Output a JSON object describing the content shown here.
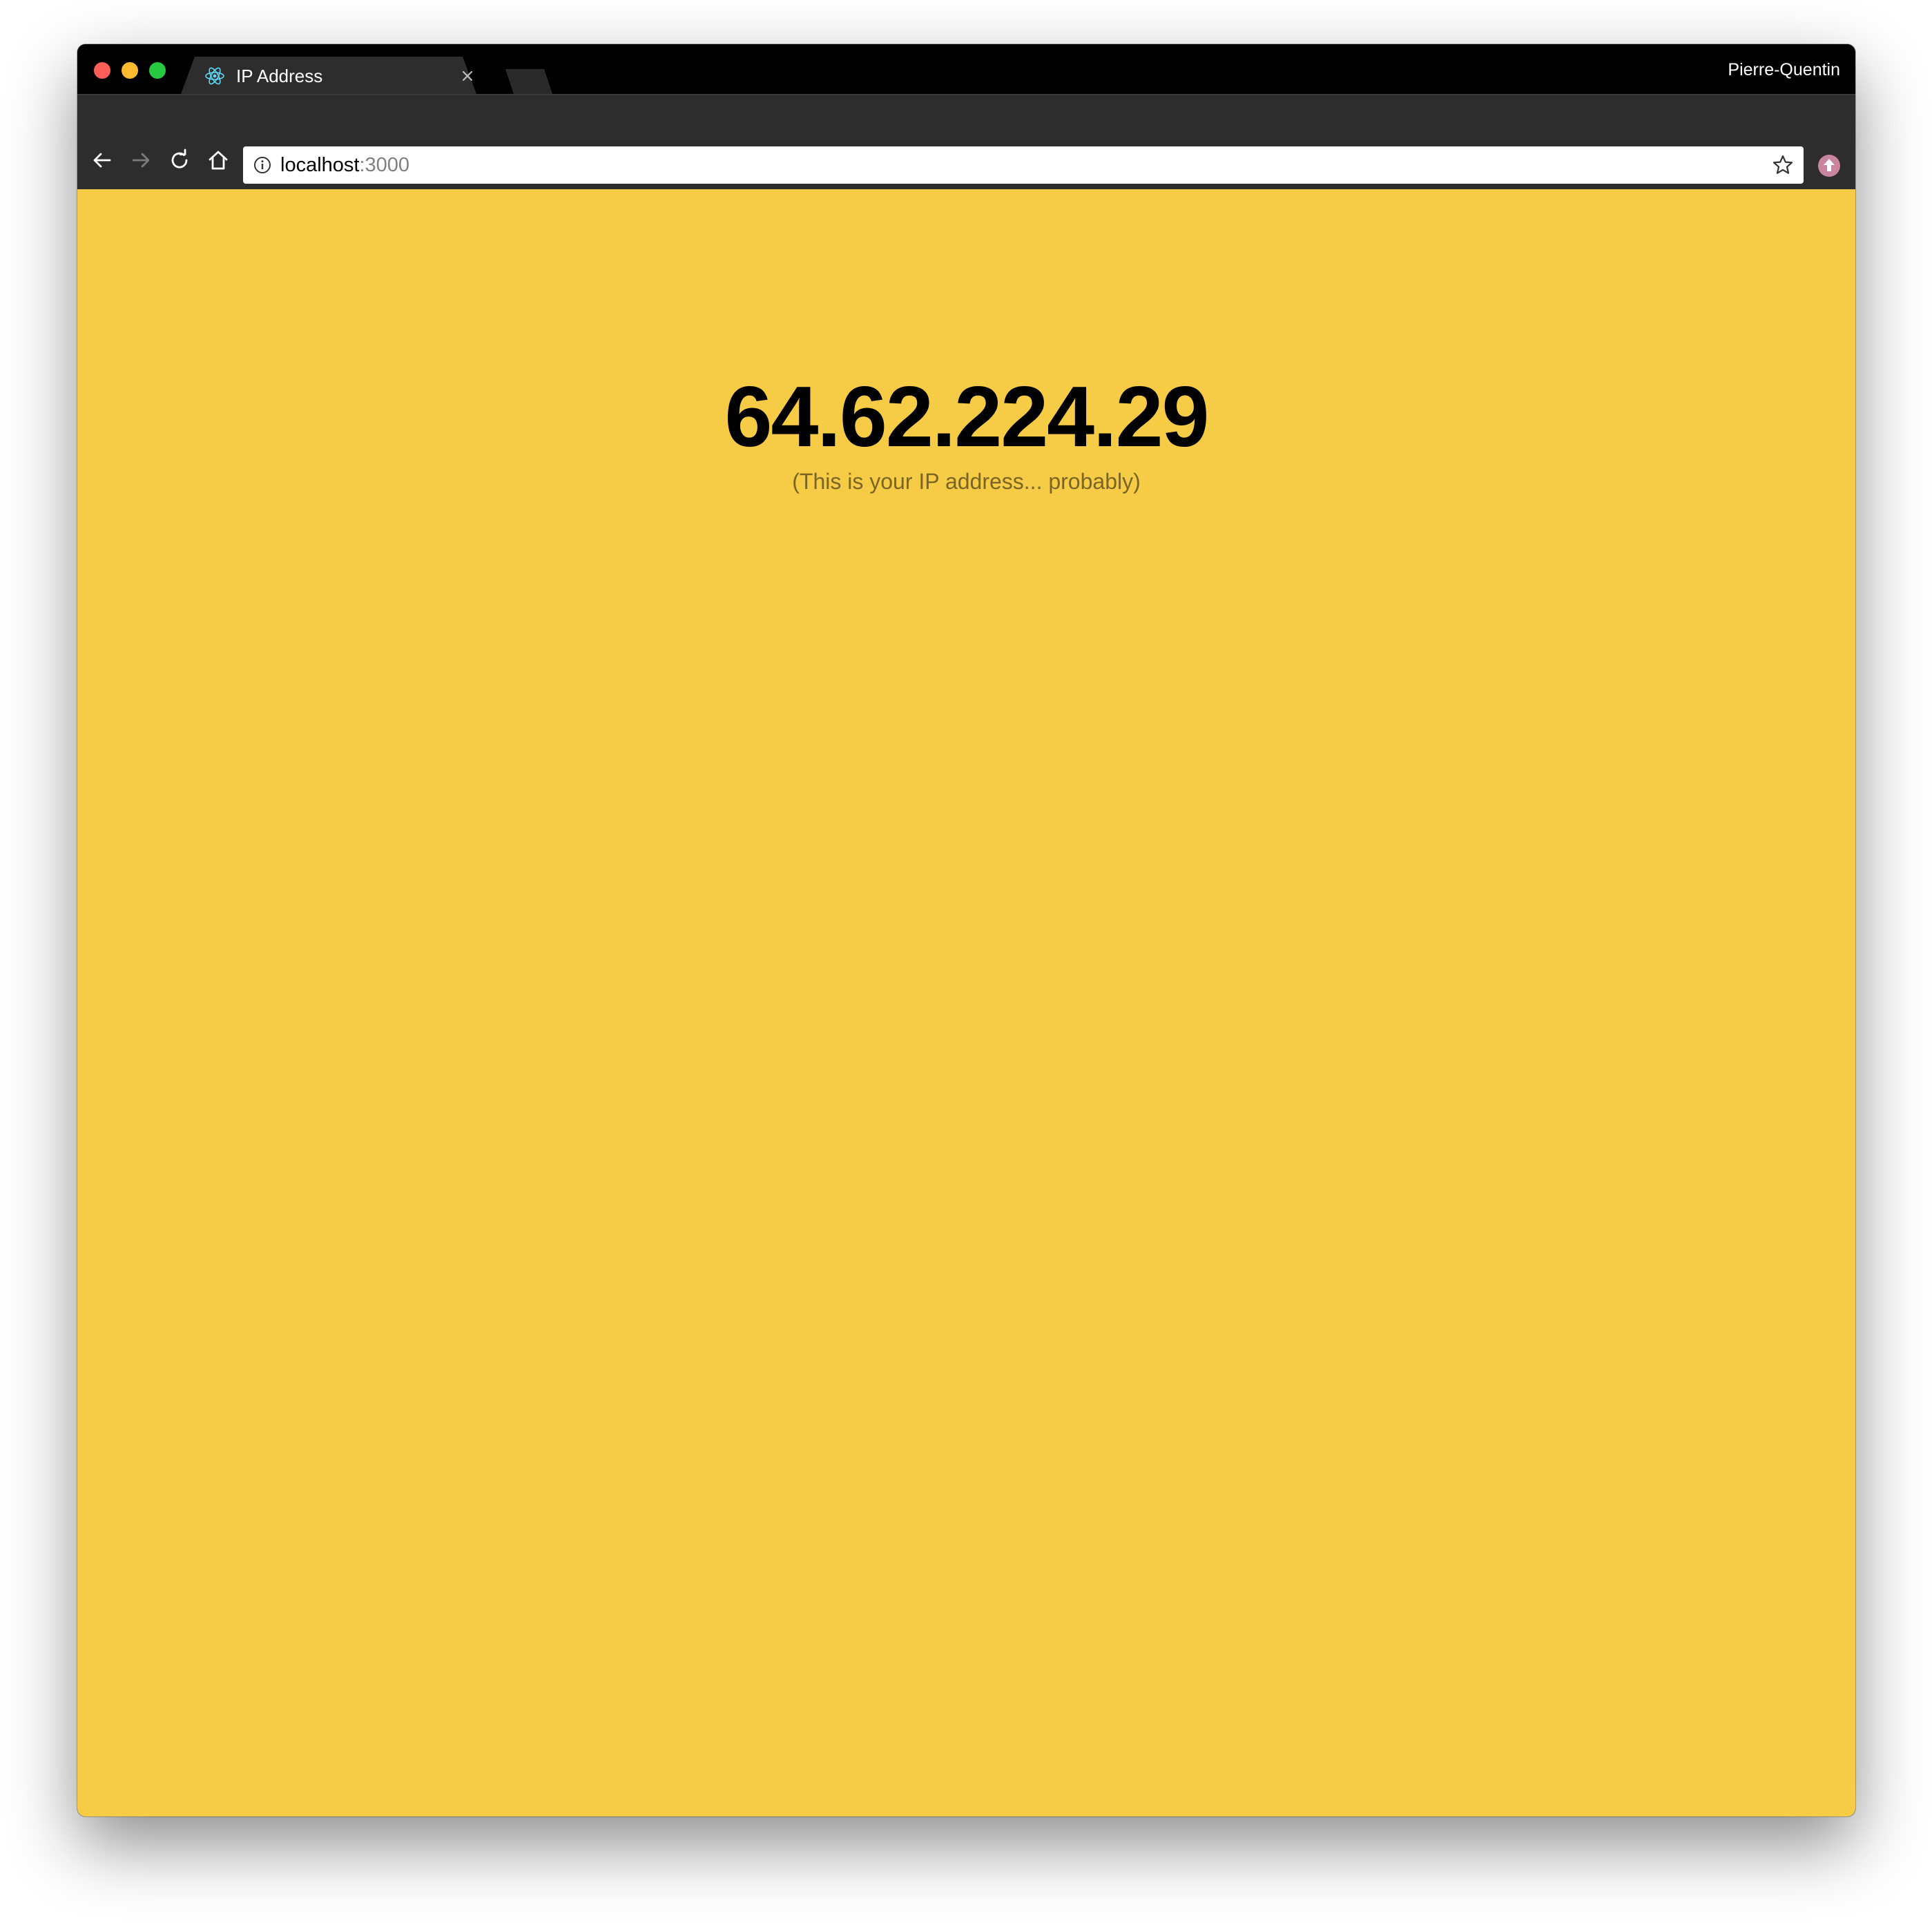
{
  "browser": {
    "tab_title": "IP Address",
    "profile_name": "Pierre-Quentin",
    "url_host": "localhost",
    "url_port": ":3000"
  },
  "page": {
    "ip_address": "64.62.224.29",
    "subtitle": "(This is your IP address... probably)"
  },
  "colors": {
    "background": "#f6cb45",
    "text": "#000000",
    "subtitle": "#7a6525"
  }
}
